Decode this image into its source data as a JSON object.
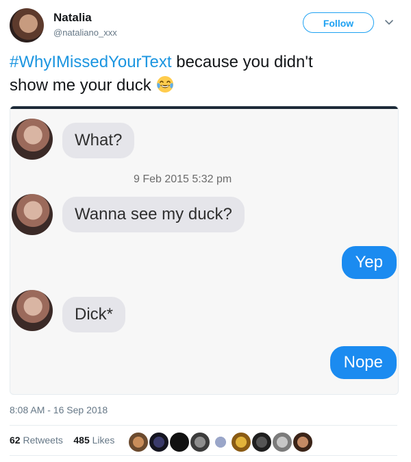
{
  "header": {
    "display_name": "Natalia",
    "handle": "@nataliano_xxx",
    "follow_label": "Follow"
  },
  "tweet": {
    "hashtag": "#WhyIMissedYourText",
    "text_line1_rest": " because you didn't",
    "text_line2": "show me your duck",
    "emoji_icon": "face-with-tears-of-joy-icon"
  },
  "media": {
    "messages": [
      {
        "from": "in",
        "text": "What?"
      },
      {
        "from": "timestamp",
        "text": "9 Feb 2015 5:32 pm"
      },
      {
        "from": "in",
        "text": "Wanna see my duck?"
      },
      {
        "from": "out",
        "text": "Yep"
      },
      {
        "from": "in",
        "text": "Dick*"
      },
      {
        "from": "out",
        "text": "Nope"
      }
    ],
    "bubble_in_color": "#e5e5ea",
    "bubble_out_color": "#1b8bf0"
  },
  "meta": {
    "time": "8:08 AM - 16 Sep 2018",
    "retweets_count": "62",
    "retweets_label": "Retweets",
    "likes_count": "485",
    "likes_label": "Likes"
  },
  "colors": {
    "accent": "#1da1f2",
    "hashtag": "#1b95e0",
    "muted": "#657786"
  }
}
